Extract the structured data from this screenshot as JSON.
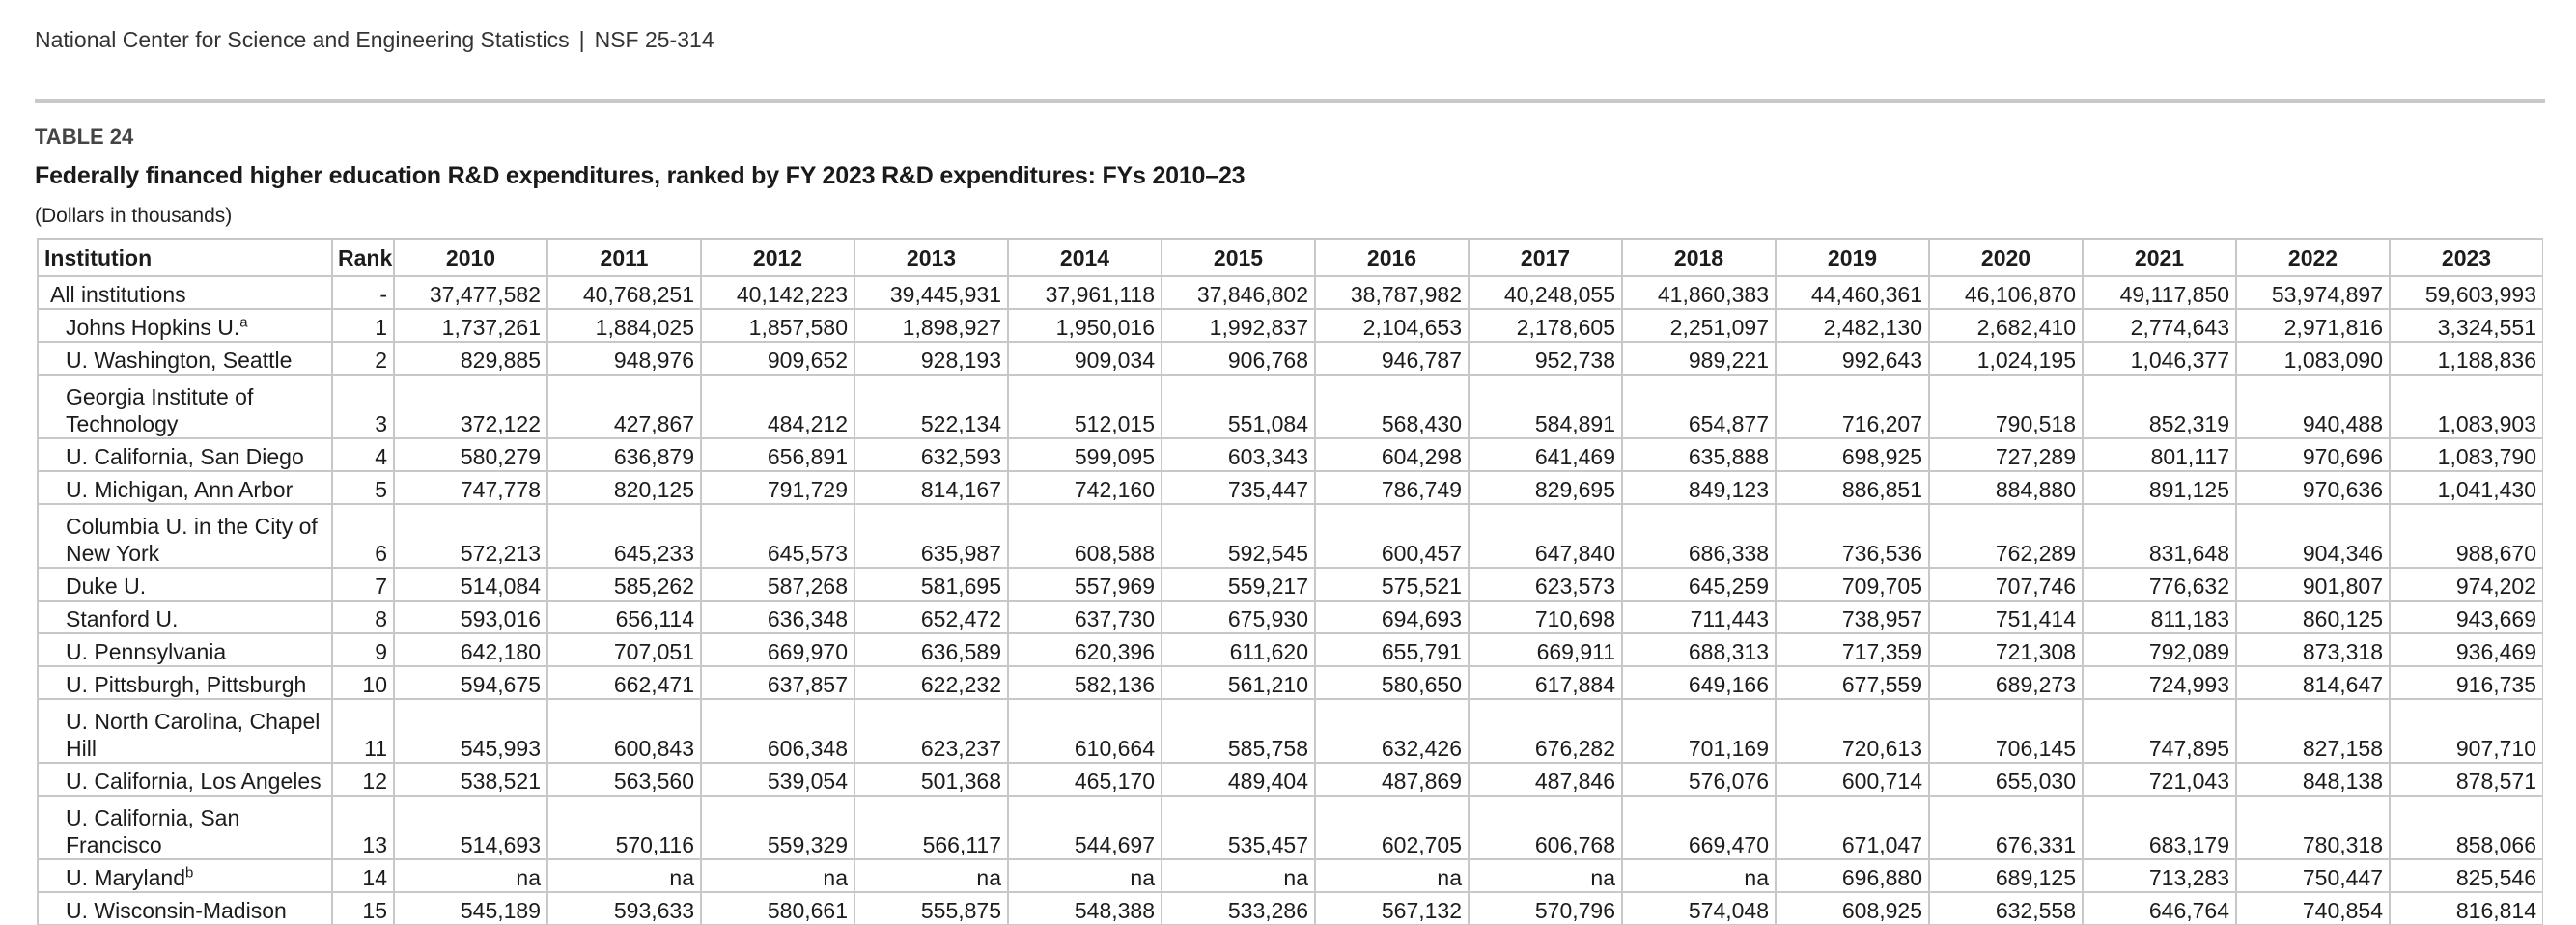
{
  "header": {
    "agency": "National Center for Science and Engineering Statistics",
    "separator": "|",
    "report_id": "NSF 25-314"
  },
  "table": {
    "label": "TABLE 24",
    "title": "Federally financed higher education R&D expenditures, ranked by FY 2023 R&D expenditures: FYs 2010–23",
    "note": "(Dollars in thousands)",
    "columns": [
      "Institution",
      "Rank",
      "2010",
      "2011",
      "2012",
      "2013",
      "2014",
      "2015",
      "2016",
      "2017",
      "2018",
      "2019",
      "2020",
      "2021",
      "2022",
      "2023"
    ],
    "rows": [
      {
        "institution": "All institutions",
        "footnote": "",
        "rank": "-",
        "values": [
          "37,477,582",
          "40,768,251",
          "40,142,223",
          "39,445,931",
          "37,961,118",
          "37,846,802",
          "38,787,982",
          "40,248,055",
          "41,860,383",
          "44,460,361",
          "46,106,870",
          "49,117,850",
          "53,974,897",
          "59,603,993"
        ]
      },
      {
        "institution": "Johns Hopkins U.",
        "footnote": "a",
        "rank": "1",
        "values": [
          "1,737,261",
          "1,884,025",
          "1,857,580",
          "1,898,927",
          "1,950,016",
          "1,992,837",
          "2,104,653",
          "2,178,605",
          "2,251,097",
          "2,482,130",
          "2,682,410",
          "2,774,643",
          "2,971,816",
          "3,324,551"
        ]
      },
      {
        "institution": "U. Washington, Seattle",
        "footnote": "",
        "rank": "2",
        "values": [
          "829,885",
          "948,976",
          "909,652",
          "928,193",
          "909,034",
          "906,768",
          "946,787",
          "952,738",
          "989,221",
          "992,643",
          "1,024,195",
          "1,046,377",
          "1,083,090",
          "1,188,836"
        ]
      },
      {
        "institution": "Georgia Institute of Technology",
        "footnote": "",
        "rank": "3",
        "values": [
          "372,122",
          "427,867",
          "484,212",
          "522,134",
          "512,015",
          "551,084",
          "568,430",
          "584,891",
          "654,877",
          "716,207",
          "790,518",
          "852,319",
          "940,488",
          "1,083,903"
        ]
      },
      {
        "institution": "U. California, San Diego",
        "footnote": "",
        "rank": "4",
        "values": [
          "580,279",
          "636,879",
          "656,891",
          "632,593",
          "599,095",
          "603,343",
          "604,298",
          "641,469",
          "635,888",
          "698,925",
          "727,289",
          "801,117",
          "970,696",
          "1,083,790"
        ]
      },
      {
        "institution": "U. Michigan, Ann Arbor",
        "footnote": "",
        "rank": "5",
        "values": [
          "747,778",
          "820,125",
          "791,729",
          "814,167",
          "742,160",
          "735,447",
          "786,749",
          "829,695",
          "849,123",
          "886,851",
          "884,880",
          "891,125",
          "970,636",
          "1,041,430"
        ]
      },
      {
        "institution": "Columbia U. in the City of New York",
        "footnote": "",
        "rank": "6",
        "values": [
          "572,213",
          "645,233",
          "645,573",
          "635,987",
          "608,588",
          "592,545",
          "600,457",
          "647,840",
          "686,338",
          "736,536",
          "762,289",
          "831,648",
          "904,346",
          "988,670"
        ]
      },
      {
        "institution": "Duke U.",
        "footnote": "",
        "rank": "7",
        "values": [
          "514,084",
          "585,262",
          "587,268",
          "581,695",
          "557,969",
          "559,217",
          "575,521",
          "623,573",
          "645,259",
          "709,705",
          "707,746",
          "776,632",
          "901,807",
          "974,202"
        ]
      },
      {
        "institution": "Stanford U.",
        "footnote": "",
        "rank": "8",
        "values": [
          "593,016",
          "656,114",
          "636,348",
          "652,472",
          "637,730",
          "675,930",
          "694,693",
          "710,698",
          "711,443",
          "738,957",
          "751,414",
          "811,183",
          "860,125",
          "943,669"
        ]
      },
      {
        "institution": "U. Pennsylvania",
        "footnote": "",
        "rank": "9",
        "values": [
          "642,180",
          "707,051",
          "669,970",
          "636,589",
          "620,396",
          "611,620",
          "655,791",
          "669,911",
          "688,313",
          "717,359",
          "721,308",
          "792,089",
          "873,318",
          "936,469"
        ]
      },
      {
        "institution": "U. Pittsburgh, Pittsburgh",
        "footnote": "",
        "rank": "10",
        "values": [
          "594,675",
          "662,471",
          "637,857",
          "622,232",
          "582,136",
          "561,210",
          "580,650",
          "617,884",
          "649,166",
          "677,559",
          "689,273",
          "724,993",
          "814,647",
          "916,735"
        ]
      },
      {
        "institution": "U. North Carolina, Chapel Hill",
        "footnote": "",
        "rank": "11",
        "values": [
          "545,993",
          "600,843",
          "606,348",
          "623,237",
          "610,664",
          "585,758",
          "632,426",
          "676,282",
          "701,169",
          "720,613",
          "706,145",
          "747,895",
          "827,158",
          "907,710"
        ]
      },
      {
        "institution": "U. California, Los Angeles",
        "footnote": "",
        "rank": "12",
        "values": [
          "538,521",
          "563,560",
          "539,054",
          "501,368",
          "465,170",
          "489,404",
          "487,869",
          "487,846",
          "576,076",
          "600,714",
          "655,030",
          "721,043",
          "848,138",
          "878,571"
        ]
      },
      {
        "institution": "U. California, San Francisco",
        "footnote": "",
        "rank": "13",
        "values": [
          "514,693",
          "570,116",
          "559,329",
          "566,117",
          "544,697",
          "535,457",
          "602,705",
          "606,768",
          "669,470",
          "671,047",
          "676,331",
          "683,179",
          "780,318",
          "858,066"
        ]
      },
      {
        "institution": "U. Maryland",
        "footnote": "b",
        "rank": "14",
        "values": [
          "na",
          "na",
          "na",
          "na",
          "na",
          "na",
          "na",
          "na",
          "na",
          "696,880",
          "689,125",
          "713,283",
          "750,447",
          "825,546"
        ]
      },
      {
        "institution": "U. Wisconsin-Madison",
        "footnote": "",
        "rank": "15",
        "values": [
          "545,189",
          "593,633",
          "580,661",
          "555,875",
          "548,388",
          "533,286",
          "567,132",
          "570,796",
          "574,048",
          "608,925",
          "632,558",
          "646,764",
          "740,854",
          "816,814"
        ]
      }
    ]
  }
}
